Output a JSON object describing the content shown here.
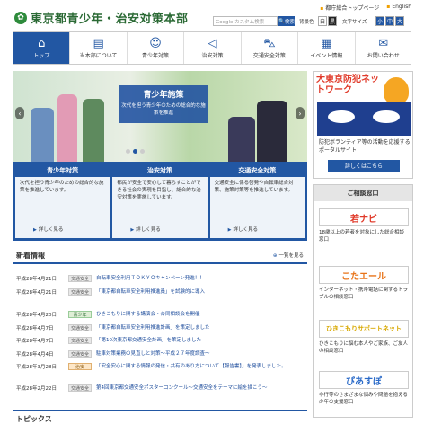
{
  "header": {
    "site_title": "東京都青少年・治安対策本部",
    "top_links": [
      "都庁総合トップページ",
      "English"
    ],
    "search_placeholder": "Google カスタム検索",
    "search_button": "検索",
    "bg_color_label": "背景色",
    "bg_options": [
      "白",
      "黒"
    ],
    "font_size_label": "文字サイズ",
    "font_sizes": [
      "小",
      "中",
      "大"
    ]
  },
  "nav": [
    {
      "label": "トップ",
      "icon": "home-icon"
    },
    {
      "label": "当本部について",
      "icon": "building-icon"
    },
    {
      "label": "青少年対策",
      "icon": "people-icon"
    },
    {
      "label": "治安対策",
      "icon": "megaphone-icon"
    },
    {
      "label": "交通安全対策",
      "icon": "car-icon"
    },
    {
      "label": "イベント情報",
      "icon": "calendar-icon"
    },
    {
      "label": "お問い合わせ",
      "icon": "mail-icon"
    }
  ],
  "hero": {
    "title": "青少年施策",
    "subtitle": "次代を担う青少年のための総合的な施策を推進"
  },
  "cards": [
    {
      "title": "青少年対策",
      "desc": "次代を担う青少年のための総合的な施策を推進しています。",
      "more": "詳しく見る"
    },
    {
      "title": "治安対策",
      "desc": "都民が安全で安心して暮らすことができる社会の実現を目指し、総合的な治安対策を実施しています。",
      "more": "詳しく見る"
    },
    {
      "title": "交通安全対策",
      "desc": "交通安全に係る啓発や自転車総合対策、施策対策等を推進しています。",
      "more": "詳しく見る"
    }
  ],
  "news": {
    "heading": "新着情報",
    "list_link": "一覧を見る",
    "items": [
      {
        "date": "平成28年4月21日",
        "badge": "交通安全",
        "text": "自転車安全利用ＴＯＫＹＯキャンペーン発進！！"
      },
      {
        "date": "平成28年4月21日",
        "badge": "交通安全",
        "text": "「東京都自転車安全利用推進員」を試験的に導入"
      },
      {
        "date": "平成28年4月20日",
        "badge": "青少年",
        "text": "ひきこもりに関する講演会・合同相談会を開催"
      },
      {
        "date": "平成28年4月7日",
        "badge": "交通安全",
        "text": "「東京都自転車安全利用推進計画」を策定しました"
      },
      {
        "date": "平成28年4月7日",
        "badge": "交通安全",
        "text": "「第10次東京都交通安全計画」を策定しました"
      },
      {
        "date": "平成28年4月4日",
        "badge": "交通安全",
        "text": "駐車対策業務の見直しと対策～平成２７年度調査～"
      },
      {
        "date": "平成28年3月28日",
        "badge": "治安",
        "text": "「安全安心に関する情報の発信・共有のあり方について【報告書】」を発表しました。"
      },
      {
        "date": "平成28年2月22日",
        "badge": "交通安全",
        "text": "第4回東京都交通安全ポスターコンクール～交通安全をテーマに絵を描こう～"
      }
    ]
  },
  "topics_heading": "トピックス",
  "side_ad": {
    "title": "大東京防犯ネットワーク",
    "desc": "防犯ボランティア等の活動を応援するポータルサイト",
    "button": "詳しくはこちら"
  },
  "consult": {
    "heading": "ご相談窓口",
    "blocks": [
      {
        "logo": "若ナビ",
        "desc": "18歳以上の若者を対象にした総合相談窓口",
        "color": "#e03a2a"
      },
      {
        "logo": "こたエール",
        "desc": "インターネット・携帯電話に関するトラブルの相談窓口",
        "color": "#e8741a"
      },
      {
        "logo": "ひきこもりサポートネット",
        "desc": "ひきこもりに悩む本人やご家族、ご友人の相談窓口",
        "color": "#d8a800"
      },
      {
        "logo": "ぴあすぽ",
        "desc": "非行等のさまざまな悩みや問題を抱える少年の支援窓口",
        "color": "#2a6ac8"
      }
    ]
  }
}
